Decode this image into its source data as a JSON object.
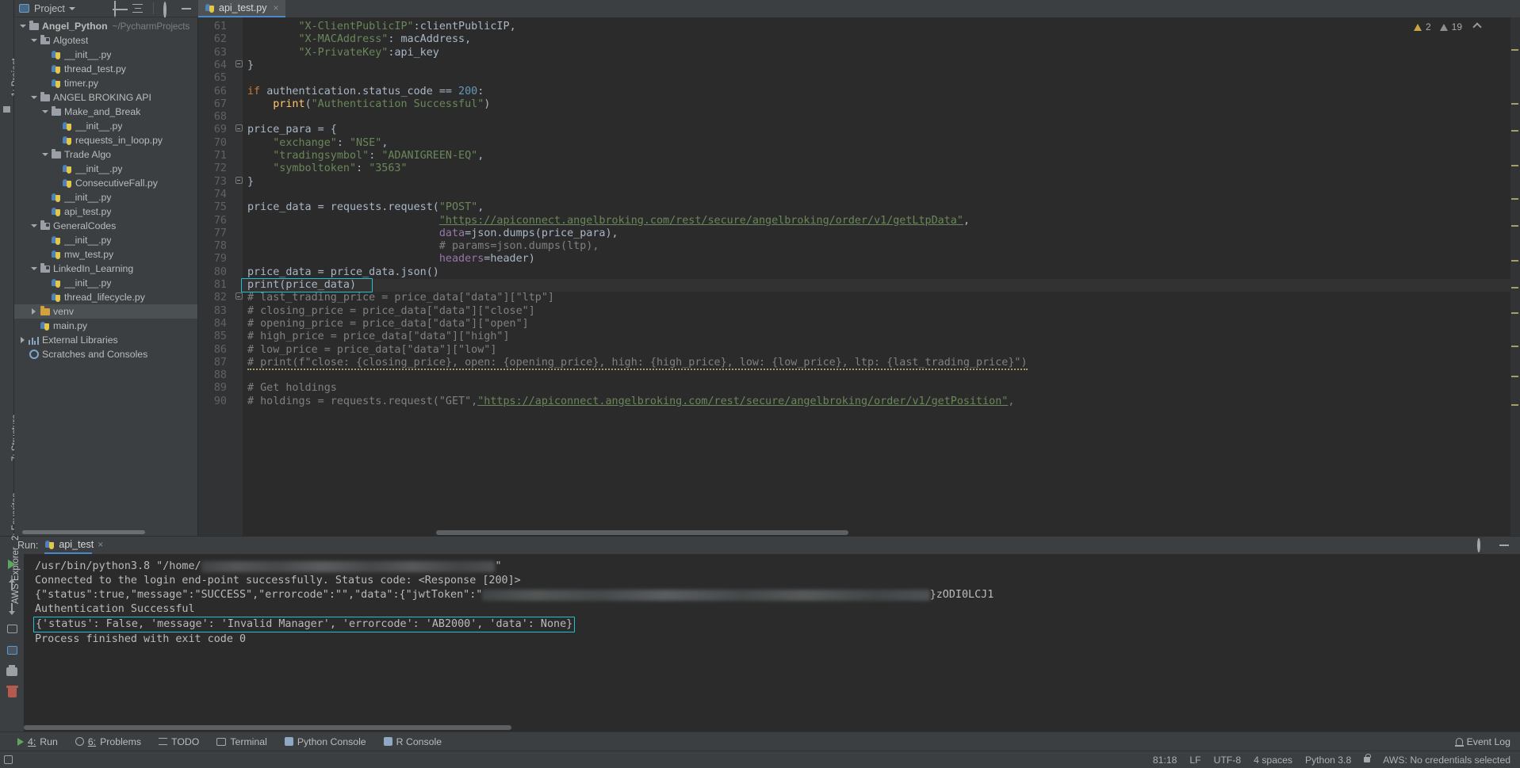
{
  "project_panel": {
    "title": "Project",
    "vertical_label": "1: Project",
    "icons": [
      "crosshair-locate-icon",
      "collapse-all-icon",
      "settings-gear-icon",
      "hide-minimize-icon"
    ],
    "tree": [
      {
        "label": "Angel_Python",
        "path": "~/PycharmProjects",
        "icon": "folder-icon",
        "indent": 0,
        "expanded": true,
        "bold": true
      },
      {
        "label": "Algotest",
        "icon": "source-folder-icon",
        "indent": 1,
        "expanded": true
      },
      {
        "label": "__init__.py",
        "icon": "python-file-icon",
        "indent": 2
      },
      {
        "label": "thread_test.py",
        "icon": "python-file-icon",
        "indent": 2
      },
      {
        "label": "timer.py",
        "icon": "python-file-icon",
        "indent": 2
      },
      {
        "label": "ANGEL BROKING API",
        "icon": "folder-icon",
        "indent": 1,
        "expanded": true
      },
      {
        "label": "Make_and_Break",
        "icon": "folder-icon",
        "indent": 2,
        "expanded": true
      },
      {
        "label": "__init__.py",
        "icon": "python-file-icon",
        "indent": 3
      },
      {
        "label": "requests_in_loop.py",
        "icon": "python-file-icon",
        "indent": 3
      },
      {
        "label": "Trade Algo",
        "icon": "folder-icon",
        "indent": 2,
        "expanded": true
      },
      {
        "label": "__init__.py",
        "icon": "python-file-icon",
        "indent": 3
      },
      {
        "label": "ConsecutiveFall.py",
        "icon": "python-file-icon",
        "indent": 3
      },
      {
        "label": "__init__.py",
        "icon": "python-file-icon",
        "indent": 2
      },
      {
        "label": "api_test.py",
        "icon": "python-file-icon",
        "indent": 2
      },
      {
        "label": "GeneralCodes",
        "icon": "source-folder-icon",
        "indent": 1,
        "expanded": true
      },
      {
        "label": "__init__.py",
        "icon": "python-file-icon",
        "indent": 2
      },
      {
        "label": "mw_test.py",
        "icon": "python-file-icon",
        "indent": 2
      },
      {
        "label": "LinkedIn_Learning",
        "icon": "source-folder-icon",
        "indent": 1,
        "expanded": true
      },
      {
        "label": "__init__.py",
        "icon": "python-file-icon",
        "indent": 2
      },
      {
        "label": "thread_lifecycle.py",
        "icon": "python-file-icon",
        "indent": 2
      },
      {
        "label": "venv",
        "icon": "venv-folder-icon",
        "indent": 1,
        "expanded": false,
        "selected": true
      },
      {
        "label": "main.py",
        "icon": "python-file-icon",
        "indent": 1
      },
      {
        "label": "External Libraries",
        "icon": "external-libraries-icon",
        "indent": 0,
        "expanded": false
      },
      {
        "label": "Scratches and Consoles",
        "icon": "scratches-icon",
        "indent": 0
      }
    ]
  },
  "editor": {
    "tab": {
      "label": "api_test.py",
      "icon": "python-file-icon",
      "close": "×"
    },
    "inspections": {
      "warnings": "2",
      "weak_warnings": "19"
    },
    "first_line_number": 61,
    "lines": [
      {
        "n": 61,
        "tokens": [
          {
            "t": "        ",
            "c": "id"
          },
          {
            "t": "\"X-ClientPublicIP\"",
            "c": "s"
          },
          {
            "t": ":",
            "c": "id"
          },
          {
            "t": "clientPublicIP",
            "c": "id"
          },
          {
            "t": ",",
            "c": "id"
          }
        ]
      },
      {
        "n": 62,
        "tokens": [
          {
            "t": "        ",
            "c": "id"
          },
          {
            "t": "\"X-MACAddress\"",
            "c": "s"
          },
          {
            "t": ": ",
            "c": "id"
          },
          {
            "t": "macAddress",
            "c": "id"
          },
          {
            "t": ",",
            "c": "id"
          }
        ]
      },
      {
        "n": 63,
        "tokens": [
          {
            "t": "        ",
            "c": "id"
          },
          {
            "t": "\"X-PrivateKey\"",
            "c": "s"
          },
          {
            "t": ":",
            "c": "id"
          },
          {
            "t": "api_key",
            "c": "id"
          }
        ]
      },
      {
        "n": 64,
        "fold": "end",
        "tokens": [
          {
            "t": "}",
            "c": "id"
          }
        ]
      },
      {
        "n": 65,
        "tokens": []
      },
      {
        "n": 66,
        "tokens": [
          {
            "t": "if ",
            "c": "k"
          },
          {
            "t": "authentication.status_code == ",
            "c": "id"
          },
          {
            "t": "200",
            "c": "n"
          },
          {
            "t": ":",
            "c": "id"
          }
        ]
      },
      {
        "n": 67,
        "tokens": [
          {
            "t": "    ",
            "c": "id"
          },
          {
            "t": "print",
            "c": "f"
          },
          {
            "t": "(",
            "c": "id"
          },
          {
            "t": "\"Authentication Successful\"",
            "c": "s"
          },
          {
            "t": ")",
            "c": "id"
          }
        ]
      },
      {
        "n": 68,
        "tokens": []
      },
      {
        "n": 69,
        "fold": "start",
        "tokens": [
          {
            "t": "price_para = {",
            "c": "id"
          }
        ]
      },
      {
        "n": 70,
        "tokens": [
          {
            "t": "    ",
            "c": "id"
          },
          {
            "t": "\"exchange\"",
            "c": "s"
          },
          {
            "t": ": ",
            "c": "id"
          },
          {
            "t": "\"NSE\"",
            "c": "s"
          },
          {
            "t": ",",
            "c": "id"
          }
        ]
      },
      {
        "n": 71,
        "tokens": [
          {
            "t": "    ",
            "c": "id"
          },
          {
            "t": "\"tradingsymbol\"",
            "c": "s"
          },
          {
            "t": ": ",
            "c": "id"
          },
          {
            "t": "\"ADANIGREEN-EQ\"",
            "c": "s"
          },
          {
            "t": ",",
            "c": "id"
          }
        ]
      },
      {
        "n": 72,
        "tokens": [
          {
            "t": "    ",
            "c": "id"
          },
          {
            "t": "\"symboltoken\"",
            "c": "s"
          },
          {
            "t": ": ",
            "c": "id"
          },
          {
            "t": "\"3563\"",
            "c": "s"
          }
        ]
      },
      {
        "n": 73,
        "fold": "end",
        "tokens": [
          {
            "t": "}",
            "c": "id"
          }
        ]
      },
      {
        "n": 74,
        "tokens": []
      },
      {
        "n": 75,
        "tokens": [
          {
            "t": "price_data = requests.request(",
            "c": "id"
          },
          {
            "t": "\"POST\"",
            "c": "s"
          },
          {
            "t": ",",
            "c": "id"
          }
        ]
      },
      {
        "n": 76,
        "tokens": [
          {
            "t": "                              ",
            "c": "id"
          },
          {
            "t": "\"https://apiconnect.angelbroking.com/rest/secure/angelbroking/order/v1/getLtpData\"",
            "c": "url"
          },
          {
            "t": ",",
            "c": "id"
          }
        ]
      },
      {
        "n": 77,
        "tokens": [
          {
            "t": "                              ",
            "c": "id"
          },
          {
            "t": "data",
            "c": "p"
          },
          {
            "t": "=json.dumps(price_para),",
            "c": "id"
          }
        ]
      },
      {
        "n": 78,
        "tokens": [
          {
            "t": "                              ",
            "c": "id"
          },
          {
            "t": "# params=json.dumps(ltp),",
            "c": "c"
          }
        ]
      },
      {
        "n": 79,
        "tokens": [
          {
            "t": "                              ",
            "c": "id"
          },
          {
            "t": "headers",
            "c": "p"
          },
          {
            "t": "=header)",
            "c": "id"
          }
        ]
      },
      {
        "n": 80,
        "tokens": [
          {
            "t": "price_data = price_data.json()",
            "c": "id"
          }
        ]
      },
      {
        "n": 81,
        "tokens": [
          {
            "t": "print(price_data)",
            "c": "id"
          }
        ],
        "caret": true
      },
      {
        "n": 82,
        "fold": "start",
        "tokens": [
          {
            "t": "# last_trading_price = price_data[\"data\"][\"ltp\"]",
            "c": "c"
          }
        ]
      },
      {
        "n": 83,
        "tokens": [
          {
            "t": "# closing_price = price_data[\"data\"][\"close\"]",
            "c": "c"
          }
        ]
      },
      {
        "n": 84,
        "tokens": [
          {
            "t": "# opening_price = price_data[\"data\"][\"open\"]",
            "c": "c"
          }
        ]
      },
      {
        "n": 85,
        "tokens": [
          {
            "t": "# high_price = price_data[\"data\"][\"high\"]",
            "c": "c"
          }
        ]
      },
      {
        "n": 86,
        "tokens": [
          {
            "t": "# low_price = price_data[\"data\"][\"low\"]",
            "c": "c"
          }
        ]
      },
      {
        "n": 87,
        "tokens": [
          {
            "t": "# print(f\"close: {closing_price}, open: {opening_price}, high: {high_price}, low: {low_price}, ltp: {last_trading_price}\")",
            "c": "c wavy"
          }
        ]
      },
      {
        "n": 88,
        "tokens": []
      },
      {
        "n": 89,
        "tokens": [
          {
            "t": "# Get holdings",
            "c": "c"
          }
        ]
      },
      {
        "n": 90,
        "tokens": [
          {
            "t": "# holdings = requests.request(\"GET\",",
            "c": "c"
          },
          {
            "t": "\"https://apiconnect.angelbroking.com/rest/secure/angelbroking/order/v1/getPosition\"",
            "c": "url"
          },
          {
            "t": ",",
            "c": "c"
          }
        ]
      }
    ]
  },
  "run_panel": {
    "label": "Run:",
    "tab": "api_test",
    "tab_close": "×",
    "toolbar_icons": [
      "rerun-play-icon",
      "up-arrow-icon",
      "down-arrow-icon",
      "stop-icon",
      "console-toggle-icon",
      "print-icon",
      "clear-all-icon"
    ],
    "header_icons": [
      "settings-gear-icon",
      "hide-minimize-icon"
    ],
    "output": [
      {
        "text_before": "/usr/bin/python3.8 \"/home/",
        "blurred": true,
        "text_after": "\""
      },
      {
        "text": "Connected to the login end-point successfully. Status code: <Response [200]>"
      },
      {
        "text_before": "{\"status\":true,\"message\":\"SUCCESS\",\"errorcode\":\"\",\"data\":{\"jwtToken\":\"",
        "blurred": true,
        "text_after": "}zODI0LCJ1"
      },
      {
        "text": "Authentication Successful"
      },
      {
        "text": "{'status': False, 'message': 'Invalid Manager', 'errorcode': 'AB2000', 'data': None}",
        "highlighted": true
      },
      {
        "text": ""
      },
      {
        "text": "Process finished with exit code 0"
      }
    ]
  },
  "bottom_tabs": [
    {
      "num": "4",
      "label": "Run",
      "icon": "run-play-icon"
    },
    {
      "num": "6",
      "label": "Problems",
      "icon": "problems-icon"
    },
    {
      "label": "TODO",
      "icon": "todo-icon"
    },
    {
      "label": "Terminal",
      "icon": "terminal-icon"
    },
    {
      "label": "Python Console",
      "icon": "python-console-icon"
    },
    {
      "label": "R Console",
      "icon": "r-console-icon"
    }
  ],
  "event_log": {
    "label": "Event Log",
    "icon": "bell-icon"
  },
  "statusbar": {
    "caret_position": "81:18",
    "line_separator": "LF",
    "encoding": "UTF-8",
    "indent": "4 spaces",
    "interpreter": "Python 3.8",
    "lock_icon": "lock-icon",
    "aws": "AWS: No credentials selected"
  },
  "left_strips": {
    "project_label": "1: Project",
    "structure_label": "7: Structure",
    "favorites_label": "2: Favorites",
    "aws_label": "AWS Explorer"
  },
  "colors": {
    "accent_blue": "#4a88c7",
    "highlight_cyan": "#20c0d8",
    "panel_bg": "#3c3f41",
    "editor_bg": "#2b2b2b",
    "string_green": "#6a8759",
    "keyword_orange": "#cc7832"
  }
}
